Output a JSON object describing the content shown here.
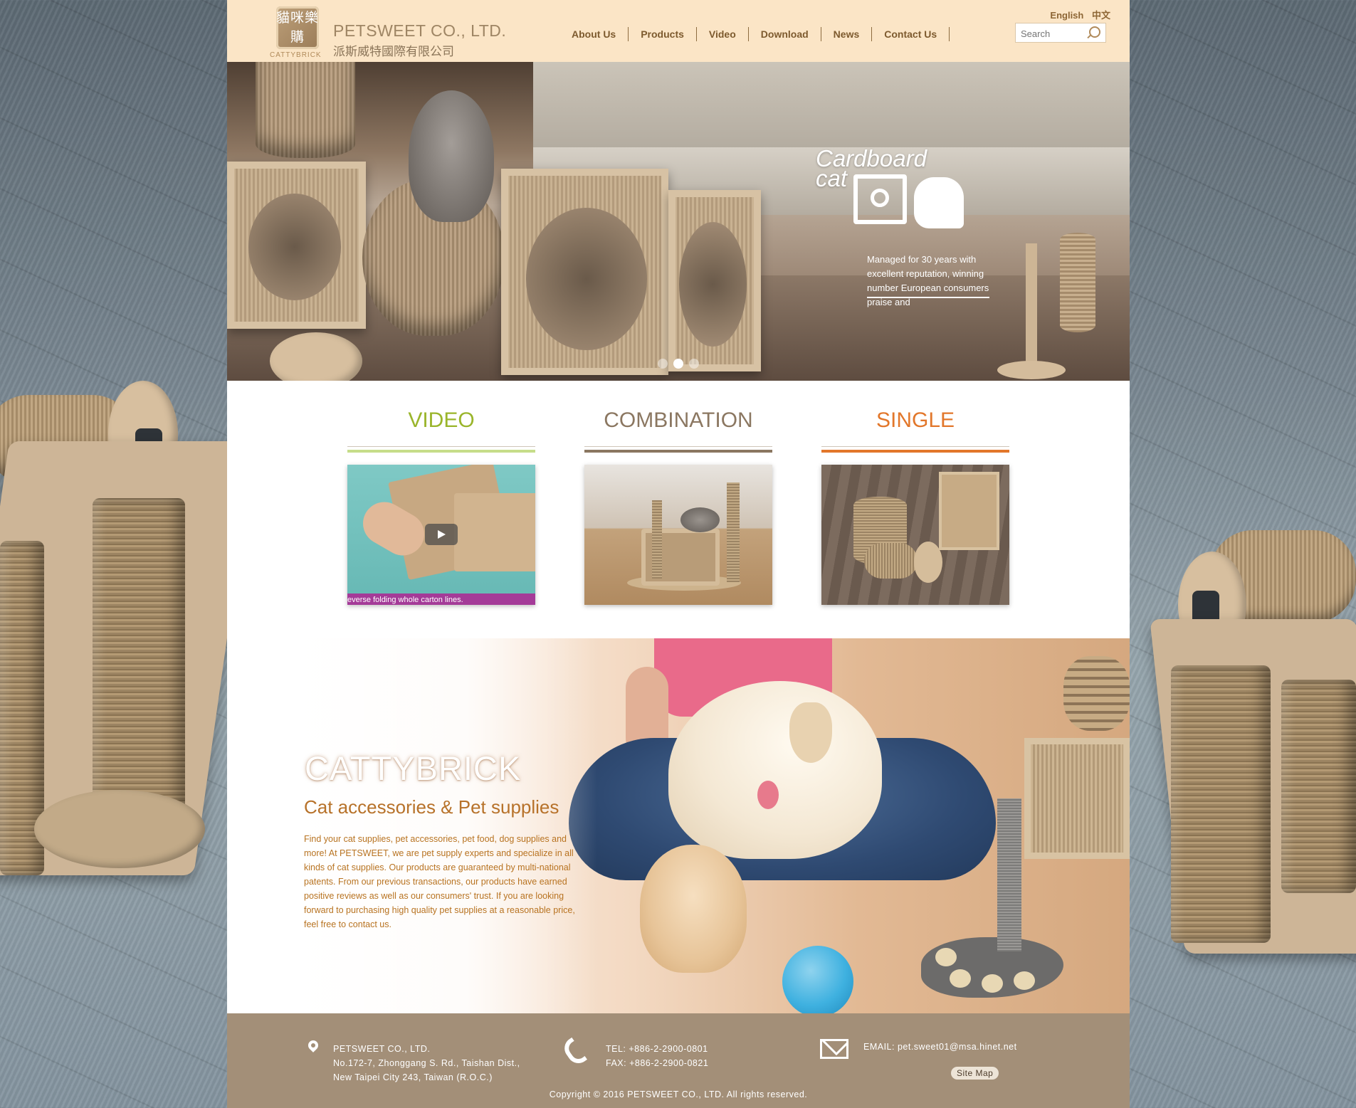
{
  "header": {
    "logo_chars": "貓咪樂購",
    "logo_sub": "CATTYBRICK",
    "company_name": "PETSWEET CO., LTD.",
    "company_name_cn": "派斯威特國際有限公司",
    "nav": [
      "About Us",
      "Products",
      "Video",
      "Download",
      "News",
      "Contact Us"
    ],
    "lang": [
      "English",
      "中文"
    ],
    "search_placeholder": "Search"
  },
  "hero": {
    "title_line1": "Cardboard",
    "title_line2": "cat",
    "text": "Managed for 30 years with excellent reputation, winning number European consumers praise and"
  },
  "categories": [
    {
      "title": "VIDEO",
      "color": "#9ab52b",
      "rule_color": "#c6dd8a",
      "caption": "everse folding whole carton lines."
    },
    {
      "title": "COMBINATION",
      "color": "#8b7761",
      "rule_color": "#8b7761"
    },
    {
      "title": "SINGLE",
      "color": "#e2772b",
      "rule_color": "#e2772b"
    }
  ],
  "about": {
    "title": "CATTYBRICK",
    "subtitle": "Cat accessories & Pet supplies",
    "text": "Find your cat supplies, pet accessories, pet food, dog supplies and more! At PETSWEET, we are pet supply experts and specialize in all kinds of cat supplies. Our products are guaranteed by multi-national patents. From our previous transactions, our products have earned positive reviews as well as our consumers' trust. If you are looking forward to purchasing high quality pet supplies at a reasonable price, feel free to contact us."
  },
  "footer": {
    "address_lines": [
      "PETSWEET CO., LTD.",
      "No.172-7, Zhonggang S. Rd., Taishan Dist.,",
      "New Taipei City 243, Taiwan (R.O.C.)"
    ],
    "tel": "TEL: +886-2-2900-0801",
    "fax": "FAX: +886-2-2900-0821",
    "email": "EMAIL: pet.sweet01@msa.hinet.net",
    "sitemap": "Site Map",
    "copyright": "Copyright © 2016 PETSWEET CO., LTD. All rights reserved."
  },
  "colors": {
    "header_bg": "#fbe5c6",
    "nav_text": "#7d5a2e",
    "about_text": "#b87321",
    "footer_bg": "#a38f78"
  }
}
